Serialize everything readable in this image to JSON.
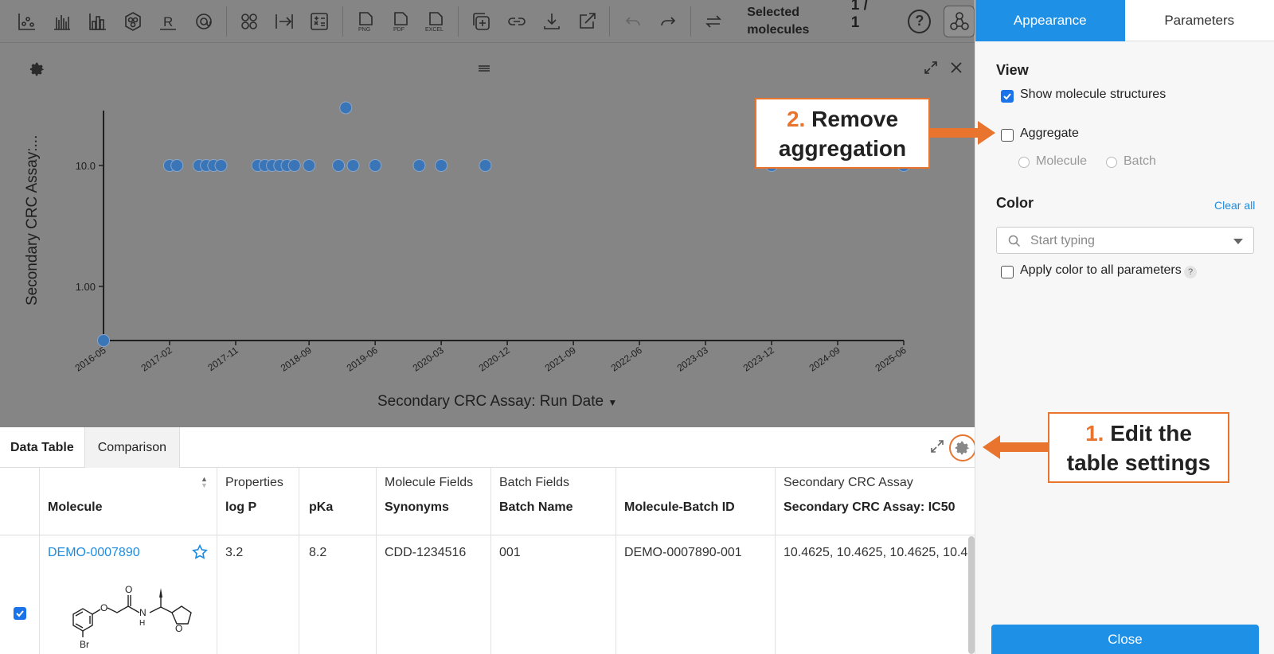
{
  "toolbar": {
    "buttons": [
      {
        "icon": "scatter-plot-icon"
      },
      {
        "icon": "bar-chart-icon"
      },
      {
        "icon": "histogram-icon"
      },
      {
        "icon": "hexagon-cluster-icon"
      },
      {
        "icon": "r-group-icon",
        "label": "R"
      },
      {
        "icon": "target-icon"
      },
      {
        "icon": "clusters-icon"
      },
      {
        "icon": "arrow-to-line-icon"
      },
      {
        "icon": "calculator-icon"
      },
      {
        "icon": "png-export-icon",
        "label": "PNG"
      },
      {
        "icon": "pdf-export-icon",
        "label": "PDF"
      },
      {
        "icon": "excel-export-icon",
        "label": "EXCEL"
      },
      {
        "icon": "add-copy-icon"
      },
      {
        "icon": "link-icon"
      },
      {
        "icon": "download-icon"
      },
      {
        "icon": "external-link-icon"
      },
      {
        "icon": "undo-icon"
      },
      {
        "icon": "redo-icon"
      },
      {
        "icon": "swap-icon"
      }
    ],
    "selected_label": "Selected molecules",
    "selected_count": "1 / 1",
    "help": "?"
  },
  "plot": {
    "xlabel": "Secondary CRC Assay: Run Date",
    "ylabel": "Secondary CRC Assay:...",
    "y_ticks": [
      "10.0",
      "1.00"
    ],
    "x_ticks": [
      "2016-05",
      "2017-02",
      "2017-11",
      "2018-09",
      "2019-06",
      "2020-03",
      "2020-12",
      "2021-09",
      "2022-06",
      "2023-03",
      "2023-12",
      "2024-09",
      "2025-06"
    ],
    "point_color": "#3a75b8"
  },
  "table": {
    "tabs": [
      "Data Table",
      "Comparison"
    ],
    "groups": [
      "Properties",
      "Molecule Fields",
      "Batch Fields",
      "Secondary CRC Assay"
    ],
    "columns": [
      "Molecule",
      "log P",
      "pKa",
      "Synonyms",
      "Batch Name",
      "Molecule-Batch ID",
      "Secondary CRC Assay: IC50"
    ],
    "row": {
      "molecule": "DEMO-0007890",
      "log_p": "3.2",
      "pka": "8.2",
      "synonyms": "CDD-1234516",
      "batch_name": "001",
      "batch_id": "DEMO-0007890-001",
      "ic50": "10.4625, 10.4625, 10.4625, 10.4625"
    },
    "structure_labels": {
      "br": "Br",
      "n": "N",
      "h": "H",
      "o1": "O",
      "o2": "O",
      "o3": "O"
    }
  },
  "panel": {
    "tabs": [
      "Appearance",
      "Parameters"
    ],
    "view_title": "View",
    "show_structures": "Show molecule structures",
    "aggregate": "Aggregate",
    "molecule": "Molecule",
    "batch": "Batch",
    "color_title": "Color",
    "clear_all": "Clear all",
    "search_placeholder": "Start typing",
    "apply_color": "Apply color to all parameters",
    "help": "?",
    "close": "Close"
  },
  "callouts": {
    "one": {
      "num": "1.",
      "line1": "Edit the",
      "line2": "table settings"
    },
    "two": {
      "num": "2.",
      "line1": "Remove",
      "line2": "aggregation"
    }
  },
  "colors": {
    "accent": "#1e90e6",
    "callout": "#e8742e",
    "overlay": "#858585"
  },
  "chart_data": {
    "type": "scatter",
    "xlabel": "Secondary CRC Assay: Run Date",
    "ylabel": "Secondary CRC Assay:...",
    "y_scale": "log",
    "x": [
      "2016-05",
      "2017-02",
      "2017-03",
      "2017-06",
      "2017-07",
      "2017-08",
      "2017-09",
      "2018-02",
      "2018-03",
      "2018-04",
      "2018-05",
      "2018-06",
      "2018-07",
      "2018-09",
      "2019-01",
      "2019-02",
      "2019-03",
      "2019-06",
      "2019-12",
      "2020-03",
      "2020-09",
      "2023-12",
      "2025-06"
    ],
    "y": [
      0.1,
      10.0,
      10.0,
      10.0,
      10.0,
      10.0,
      10.0,
      10.0,
      10.0,
      10.0,
      10.0,
      10.0,
      10.0,
      10.0,
      10.0,
      30.0,
      10.0,
      10.0,
      10.0,
      10.0,
      10.0,
      10.0,
      10.0
    ]
  }
}
